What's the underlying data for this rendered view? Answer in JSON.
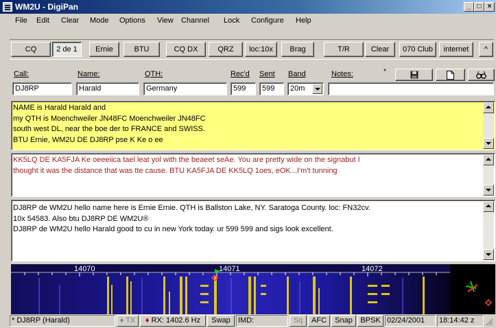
{
  "window": {
    "title": "WM2U - DigiPan"
  },
  "title_controls": {
    "minimize": "_",
    "maximize": "□",
    "close": "×"
  },
  "menu": [
    "File",
    "Edit",
    "Clear",
    "Mode",
    "Options",
    "View",
    "Channel",
    "Lock",
    "Configure",
    "Help"
  ],
  "toolbar": [
    "CQ",
    "2 de 1",
    "Ernie",
    "BTU",
    "CQ DX",
    "QRZ",
    "loc:10x",
    "Brag",
    "T/R",
    "Clear",
    "070 Club",
    "internet",
    "^"
  ],
  "log": {
    "labels": {
      "call": "Call:",
      "name": "Name:",
      "qth": "QTH:",
      "recd": "Rec'd",
      "sent": "Sent",
      "band": "Band",
      "notes": "Notes:"
    },
    "values": {
      "call": "DJ8RP",
      "name": "Harald",
      "qth": "Germany",
      "recd": "599",
      "sent": "599",
      "band": "20m",
      "notes": ""
    },
    "buttons": {
      "save": "save",
      "new": "new",
      "lookup": "lookup"
    }
  },
  "panes": {
    "receive_main": [
      "NAME is Harald Harald and",
      "my QTH is Moenchweiler JN48FC Moenchweiler JN48FC",
      "south west DL, near the boe der to FRANCE and SWISS.",
      "BTU Ernie, WM2U DE DJ8RP pse K Ke o ee"
    ],
    "receive_second": [
      "KK5LQ DE KA5FJA Ke   oeeeiica  tael leat yol with  the beaeet seAe.  You are pretty wide on the signabut I",
      "thought it was the distance that was tte cause.  BTU KA5FJA DE KK5LQ 1oes,   eOK...I'm't  tunning"
    ],
    "transmit": [
      "DJ8RP de WM2U hello  name here is Ernie Ernie. QTH is Ballston Lake, NY. Saratoga County. loc: FN32cv.",
      "10x 54583. Also btu  DJ8RP DE WM2U®",
      "DJ8RP de WM2U hello Harald good to cu in new York today. ur 599 599 and sigs look excellent."
    ]
  },
  "waterfall": {
    "freq_labels": [
      "14070",
      "14071",
      "14072"
    ]
  },
  "status": {
    "callname": "* DJ8RP (Harald)",
    "tx": "TX",
    "rx": "RX: 1402.6 Hz",
    "swap": "Swap",
    "imd": "IMD:",
    "sq": "Sq",
    "afc": "AFC",
    "snap": "Snap",
    "mode": "BPSK",
    "date": "02/24/2001",
    "time": "18:14:42 z"
  },
  "colors": {
    "receive_main_bg": "#ffff80",
    "receive_second_text": "#a02020",
    "waterfall_bg": "#0e0b4a",
    "signal": "#ffe600"
  }
}
